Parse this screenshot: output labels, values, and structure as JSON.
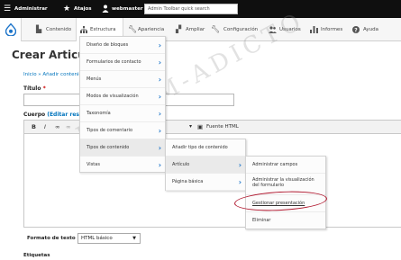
{
  "admin_bar": {
    "manage_label": "Administrar",
    "shortcuts_label": "Atajos",
    "user_label": "webmaster",
    "search_placeholder": "Admin Toolbar quick search"
  },
  "toolbar": {
    "items": [
      {
        "label": "Contenido",
        "icon": "page-icon"
      },
      {
        "label": "Estructura",
        "icon": "sitemap-icon"
      },
      {
        "label": "Apariencia",
        "icon": "wrench-icon"
      },
      {
        "label": "Ampliar",
        "icon": "puzzle-icon"
      },
      {
        "label": "Configuración",
        "icon": "wrench-icon"
      },
      {
        "label": "Usuarios",
        "icon": "people-icon"
      },
      {
        "label": "Informes",
        "icon": "bar-chart-icon"
      },
      {
        "label": "Ayuda",
        "icon": "question-icon"
      }
    ]
  },
  "page": {
    "title": "Crear Articul",
    "breadcrumb": "Inicio » Añadir contenido",
    "title_label": "Título",
    "required_mark": "*",
    "body_label": "Cuerpo",
    "edit_summary": "(Editar resum",
    "format_label": "Formato de texto",
    "format_value": "HTML básico",
    "tags_label": "Etiquetas"
  },
  "editor": {
    "bold": "B",
    "italic": "I",
    "source_label": "Fuente HTML"
  },
  "menus": {
    "structure": [
      {
        "label": "Diseño de bloques"
      },
      {
        "label": "Formularios de contacto"
      },
      {
        "label": "Menús"
      },
      {
        "label": "Modos de visualización"
      },
      {
        "label": "Taxonomía"
      },
      {
        "label": "Tipos de comentario"
      },
      {
        "label": "Tipos de contenido"
      },
      {
        "label": "Vistas"
      }
    ],
    "content_types": [
      {
        "label": "Añadir tipo de contenido"
      },
      {
        "label": "Artículo"
      },
      {
        "label": "Página básica"
      }
    ],
    "article": [
      {
        "label": "Administrar campos"
      },
      {
        "label": "Administrar la visualización del formulario"
      },
      {
        "label": "Gestionar presentación"
      },
      {
        "label": "Eliminar"
      }
    ]
  },
  "watermark": "DREAM-ADICTO"
}
